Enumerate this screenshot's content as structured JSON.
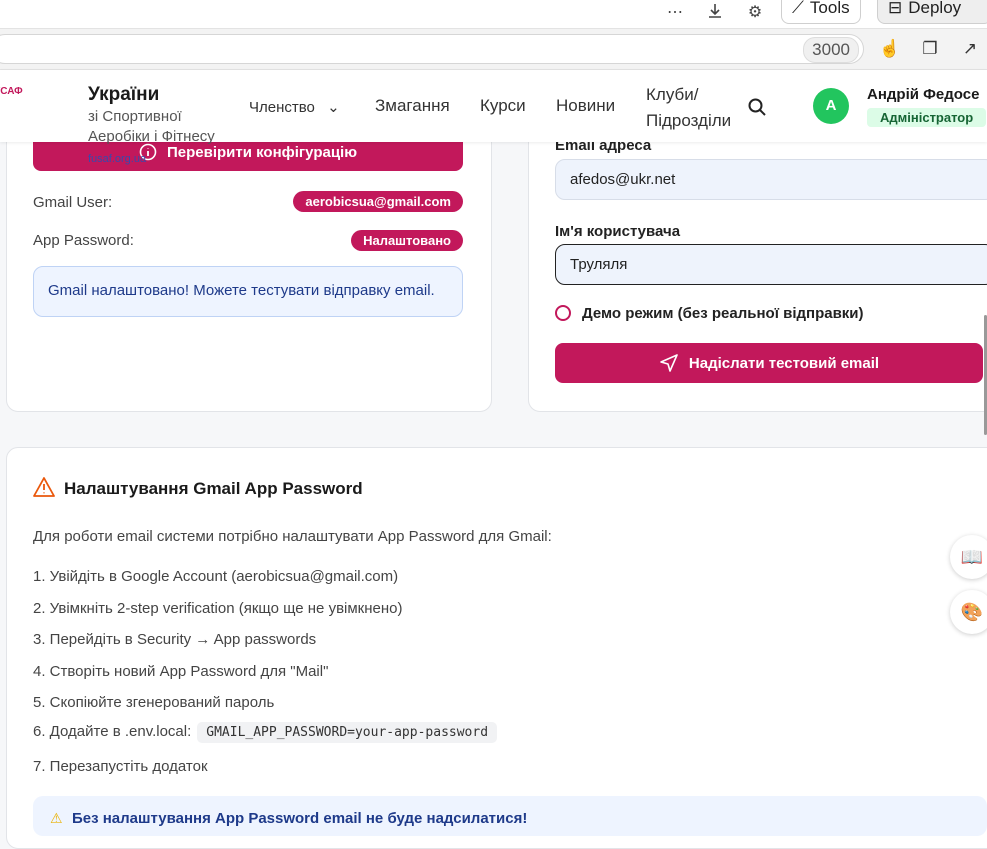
{
  "ide": {
    "tools_label": "Tools",
    "deploy_label": "Deploy",
    "port": "3000"
  },
  "header": {
    "org_title": "України",
    "org_sub": "зі Спортивної Аеробіки і Фітнесу",
    "org_link": "fusaf.org.ua",
    "nav": {
      "membership": "Членство",
      "competitions": "Змагання",
      "courses": "Курси",
      "news": "Новини",
      "clubs": "Клуби/ Підрозділи"
    },
    "user": {
      "initial": "А",
      "name": "Андрій Федосе",
      "role": "Адміністратор"
    }
  },
  "config_card": {
    "check_button": "Перевірити конфігурацію",
    "gmail_user_label": "Gmail User:",
    "gmail_user_value": "aerobicsua@gmail.com",
    "app_password_label": "App Password:",
    "app_password_value": "Налаштовано",
    "status_message": "Gmail налаштовано! Можете тестувати відправку email."
  },
  "test_card": {
    "email_label": "Email адреса",
    "email_value": "afedos@ukr.net",
    "username_label": "Ім'я користувача",
    "username_value": "Труляля",
    "demo_label": "Демо режим (без реальної відправки)",
    "send_button": "Надіслати тестовий email"
  },
  "setup_section": {
    "title": "Налаштування Gmail App Password",
    "intro": "Для роботи email системи потрібно налаштувати App Password для Gmail:",
    "steps": [
      "1. Увійдіть в Google Account (aerobicsua@gmail.com)",
      "2. Увімкніть 2-step verification (якщо ще не увімкнено)",
      "3. Перейдіть в Security → App passwords",
      "4. Створіть новий App Password для \"Mail\"",
      "5. Скопіюйте згенерований пароль",
      "6. Додайте в .env.local:",
      "7. Перезапустіть додаток"
    ],
    "env_code": "GMAIL_APP_PASSWORD=your-app-password",
    "warning": "Без налаштування App Password email не буде надсилатися!"
  },
  "colors": {
    "accent": "#c2185b",
    "avatar": "#22c55e",
    "info_bg": "#eef4ff"
  }
}
